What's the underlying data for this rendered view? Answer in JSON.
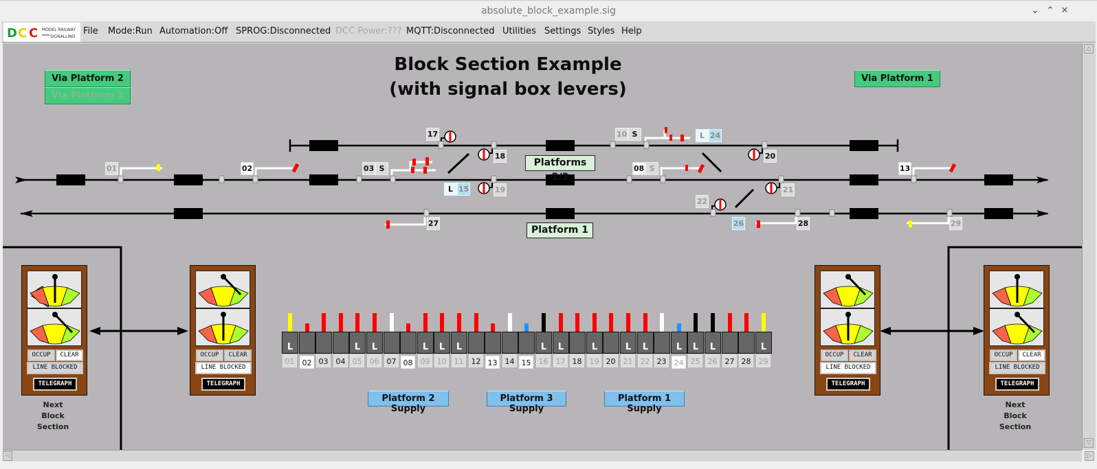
{
  "window": {
    "title": "absolute_block_example.sig",
    "controls": [
      "minimize",
      "maximize",
      "close"
    ]
  },
  "menubar": {
    "logo_text": "DCC MODEL RAILWAY SIGNALLING",
    "items": [
      {
        "label": "File",
        "enabled": true
      },
      {
        "label": "Mode:Run",
        "enabled": true
      },
      {
        "label": "Automation:Off",
        "enabled": true
      },
      {
        "label": "SPROG:Disconnected",
        "enabled": true
      },
      {
        "label": "DCC Power:???",
        "enabled": false
      },
      {
        "label": "MQTT:Disconnected",
        "enabled": true
      },
      {
        "label": "Utilities",
        "enabled": true
      },
      {
        "label": "Settings",
        "enabled": true
      },
      {
        "label": "Styles",
        "enabled": true
      },
      {
        "label": "Help",
        "enabled": true
      }
    ]
  },
  "schematic": {
    "title_line1": "Block Section Example",
    "title_line2": "(with signal box levers)",
    "route_buttons": {
      "via_platform_2": "Via Platform 2",
      "via_platform_3": "Via Platform 3",
      "via_platform_1": "Via Platform 1"
    },
    "platform_labels": {
      "platforms_23": "Platforms 2/3",
      "platform_1": "Platform 1"
    },
    "signals": [
      {
        "id": "01",
        "state": "off",
        "aspect_color": "#ffff00"
      },
      {
        "id": "02",
        "state": "on",
        "aspect_color": "#ff0000"
      },
      {
        "id": "03",
        "state": "mid",
        "subsidiary": "S"
      },
      {
        "id": "08",
        "state": "on",
        "subsidiary": "S"
      },
      {
        "id": "10",
        "state": "off",
        "subsidiary": "S"
      },
      {
        "id": "13",
        "state": "on",
        "aspect_color": "#ff0000"
      },
      {
        "id": "17",
        "state": "mid",
        "type": "ground-disc"
      },
      {
        "id": "18",
        "state": "mid",
        "type": "ground-disc"
      },
      {
        "id": "19",
        "state": "off",
        "type": "ground-disc"
      },
      {
        "id": "20",
        "state": "mid",
        "type": "ground-disc"
      },
      {
        "id": "21",
        "state": "off",
        "type": "ground-disc"
      },
      {
        "id": "22",
        "state": "off",
        "type": "ground-disc"
      },
      {
        "id": "27",
        "state": "mid",
        "aspect_color": "#ff0000"
      },
      {
        "id": "28",
        "state": "mid",
        "aspect_color": "#ff0000"
      },
      {
        "id": "29",
        "state": "off",
        "aspect_color": "#ffff00"
      }
    ],
    "points": [
      {
        "id": "15",
        "lock": "L"
      },
      {
        "id": "24",
        "lock": "L"
      },
      {
        "id": "26",
        "lock": ""
      }
    ],
    "supply_buttons": [
      "Platform 2 Supply",
      "Platform 3 Supply",
      "Platform 1 Supply"
    ]
  },
  "block_instruments": [
    {
      "id": "left-far",
      "occup": "OCCUP",
      "clear": "CLEAR",
      "line_blocked": "LINE BLOCKED",
      "telegraph": "TELEGRAPH",
      "active": "clear",
      "caption": [
        "Next",
        "Block",
        "Section"
      ]
    },
    {
      "id": "left-near",
      "occup": "OCCUP",
      "clear": "CLEAR",
      "line_blocked": "LINE BLOCKED",
      "telegraph": "TELEGRAPH",
      "active": "line_blocked"
    },
    {
      "id": "right-near",
      "occup": "OCCUP",
      "clear": "CLEAR",
      "line_blocked": "LINE BLOCKED",
      "telegraph": "TELEGRAPH",
      "active": "line_blocked"
    },
    {
      "id": "right-far",
      "occup": "OCCUP",
      "clear": "CLEAR",
      "line_blocked": "LINE BLOCKED",
      "telegraph": "TELEGRAPH",
      "active": "clear",
      "caption": [
        "Next",
        "Block",
        "Section"
      ]
    }
  ],
  "lever_frame": {
    "levers": [
      {
        "num": "01",
        "color": "#ffff00",
        "pulled": false,
        "locked": true,
        "label_state": "off"
      },
      {
        "num": "02",
        "color": "#ff0000",
        "pulled": true,
        "locked": false,
        "label_state": "on"
      },
      {
        "num": "03",
        "color": "#ff0000",
        "pulled": false,
        "locked": false,
        "label_state": "mid"
      },
      {
        "num": "04",
        "color": "#ff0000",
        "pulled": false,
        "locked": false,
        "label_state": "mid"
      },
      {
        "num": "05",
        "color": "#ff0000",
        "pulled": false,
        "locked": true,
        "label_state": "off"
      },
      {
        "num": "06",
        "color": "#ff0000",
        "pulled": false,
        "locked": true,
        "label_state": "off"
      },
      {
        "num": "07",
        "color": "#ffffff",
        "pulled": false,
        "locked": false,
        "label_state": "mid"
      },
      {
        "num": "08",
        "color": "#ff0000",
        "pulled": true,
        "locked": false,
        "label_state": "on"
      },
      {
        "num": "09",
        "color": "#ff0000",
        "pulled": false,
        "locked": true,
        "label_state": "off"
      },
      {
        "num": "10",
        "color": "#ff0000",
        "pulled": false,
        "locked": true,
        "label_state": "off"
      },
      {
        "num": "11",
        "color": "#ff0000",
        "pulled": false,
        "locked": true,
        "label_state": "off"
      },
      {
        "num": "12",
        "color": "#ff0000",
        "pulled": false,
        "locked": false,
        "label_state": "mid"
      },
      {
        "num": "13",
        "color": "#ff0000",
        "pulled": true,
        "locked": false,
        "label_state": "on"
      },
      {
        "num": "14",
        "color": "#ffffff",
        "pulled": false,
        "locked": false,
        "label_state": "mid"
      },
      {
        "num": "15",
        "color": "#1e90ff",
        "pulled": true,
        "locked": false,
        "label_state": "on"
      },
      {
        "num": "16",
        "color": "#000000",
        "pulled": false,
        "locked": true,
        "label_state": "off"
      },
      {
        "num": "17",
        "color": "#ff0000",
        "pulled": false,
        "locked": true,
        "label_state": "off"
      },
      {
        "num": "18",
        "color": "#ff0000",
        "pulled": false,
        "locked": false,
        "label_state": "mid"
      },
      {
        "num": "19",
        "color": "#ff0000",
        "pulled": false,
        "locked": true,
        "label_state": "off"
      },
      {
        "num": "20",
        "color": "#ff0000",
        "pulled": false,
        "locked": false,
        "label_state": "mid"
      },
      {
        "num": "21",
        "color": "#ff0000",
        "pulled": false,
        "locked": true,
        "label_state": "off"
      },
      {
        "num": "22",
        "color": "#ff0000",
        "pulled": false,
        "locked": true,
        "label_state": "off"
      },
      {
        "num": "23",
        "color": "#ffffff",
        "pulled": false,
        "locked": false,
        "label_state": "mid"
      },
      {
        "num": "24",
        "color": "#1e90ff",
        "pulled": true,
        "locked": true,
        "label_state": "on-dim"
      },
      {
        "num": "25",
        "color": "#000000",
        "pulled": false,
        "locked": true,
        "label_state": "off"
      },
      {
        "num": "26",
        "color": "#000000",
        "pulled": false,
        "locked": true,
        "label_state": "off"
      },
      {
        "num": "27",
        "color": "#ff0000",
        "pulled": false,
        "locked": false,
        "label_state": "mid"
      },
      {
        "num": "28",
        "color": "#ff0000",
        "pulled": false,
        "locked": false,
        "label_state": "mid"
      },
      {
        "num": "29",
        "color": "#ffff00",
        "pulled": false,
        "locked": true,
        "label_state": "off"
      }
    ],
    "lock_glyph": "L"
  }
}
